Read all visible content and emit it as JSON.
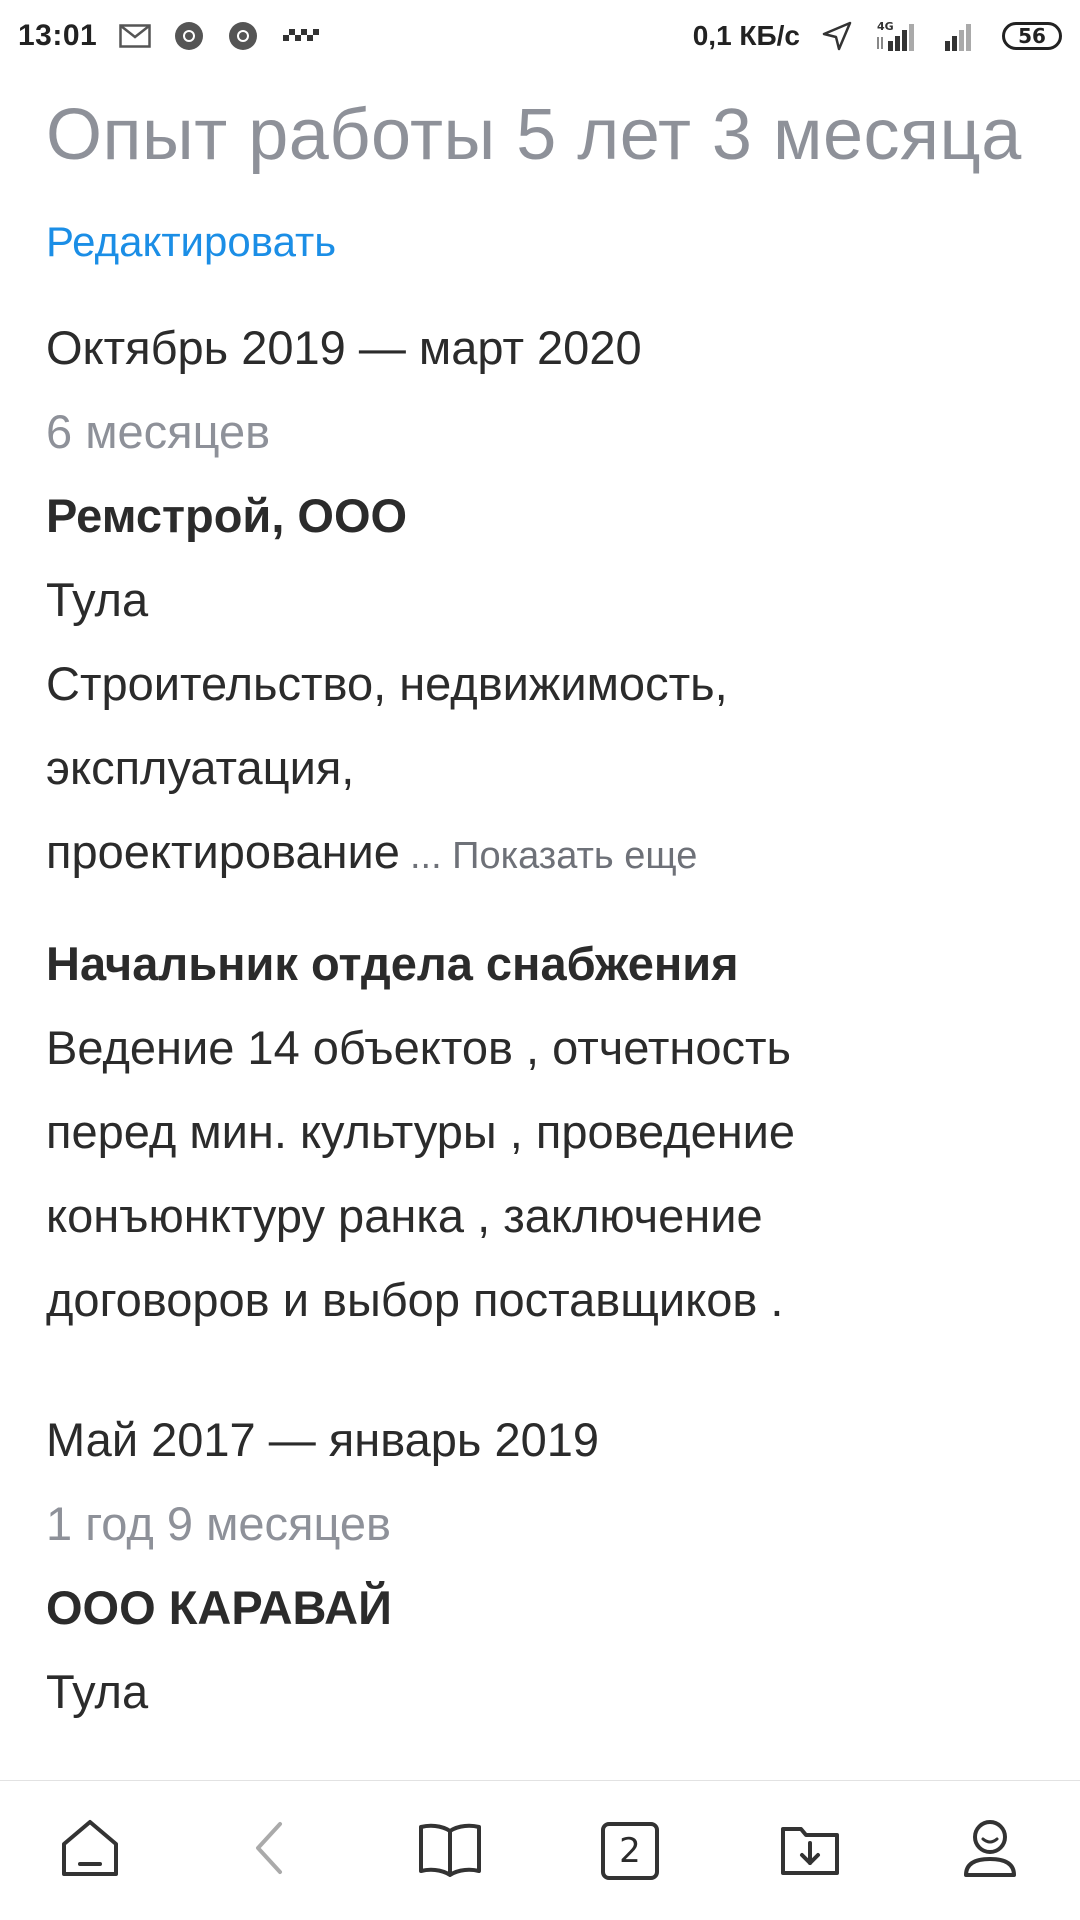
{
  "status_bar": {
    "time": "13:01",
    "net_speed": "0,1 КБ/с",
    "battery": "56",
    "left_icons": [
      "mail-icon",
      "chrome-icon",
      "chrome-icon",
      "taxi-icon"
    ],
    "right_icons": [
      "location-arrow-icon",
      "signal-4g-icon",
      "signal-icon"
    ]
  },
  "experience": {
    "title": "Опыт работы 5 лет 3 месяца",
    "edit_label": "Редактировать",
    "jobs": [
      {
        "period": "Октябрь 2019 — март 2020",
        "duration": "6 месяцев",
        "company": "Ремстрой, ООО",
        "city": "Тула",
        "industry_lines": [
          "Строительство, недвижимость,",
          "эксплуатация,",
          "проектирование"
        ],
        "show_more": "... Показать еще",
        "position": "Начальник отдела снабжения",
        "description_lines": [
          "Ведение 14 объектов , отчетность",
          "перед мин. культуры , проведение",
          "конъюнктуру ранка , заключение",
          "договоров и выбор поставщиков ."
        ]
      },
      {
        "period": "Май 2017 — январь 2019",
        "duration": "1 год 9 месяцев",
        "company": "ООО КАРАВАЙ",
        "city": "Тула"
      }
    ]
  },
  "bottom_nav": {
    "items": [
      "home-icon",
      "back-icon",
      "bookmarks-icon",
      "tabs-icon",
      "downloads-icon",
      "profile-icon"
    ],
    "tabs_count": "2"
  },
  "colors": {
    "accent": "#1b8ee6",
    "muted": "#8e9199",
    "text": "#2b2b2b"
  }
}
